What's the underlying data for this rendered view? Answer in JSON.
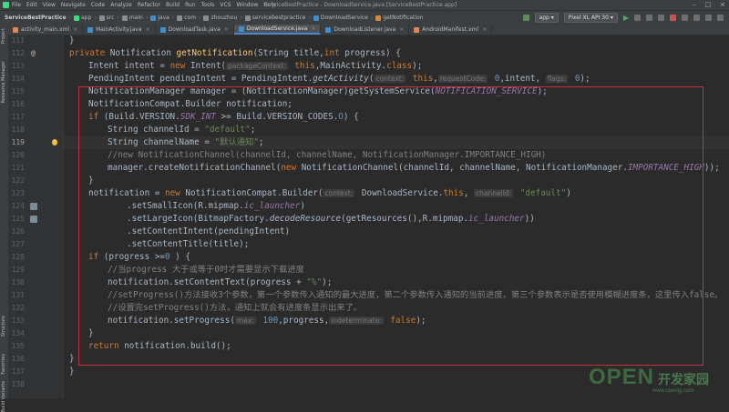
{
  "menubar": {
    "items": [
      "File",
      "Edit",
      "View",
      "Navigate",
      "Code",
      "Analyze",
      "Refactor",
      "Build",
      "Run",
      "Tools",
      "VCS",
      "Window",
      "Help"
    ],
    "window_title": "ServiceBestPractice - DownloadService.java [ServiceBestPractice.app]",
    "window_buttons": [
      "–",
      "□",
      "×"
    ]
  },
  "navbar": {
    "crumbs": [
      "ServiceBestPractice",
      "app",
      "src",
      "main",
      "java",
      "com",
      "zhouzhou",
      "servicebestpractice",
      "DownloadService",
      "getNotification"
    ],
    "config": "app",
    "device": "Pixel XL API 30"
  },
  "tabs": [
    {
      "label": "activity_main.xml",
      "active": false,
      "color": "#e08855"
    },
    {
      "label": "MainActivity.java",
      "active": false,
      "color": "#3d8fd1"
    },
    {
      "label": "DownloadTask.java",
      "active": false,
      "color": "#3d8fd1"
    },
    {
      "label": "DownloadService.java",
      "active": true,
      "color": "#3d8fd1"
    },
    {
      "label": "DownloadListener.java",
      "active": false,
      "color": "#3d8fd1"
    },
    {
      "label": "AndroidManifest.xml",
      "active": false,
      "color": "#e08855"
    }
  ],
  "leftstrip": {
    "items": [
      "Project",
      "Resource Manager",
      "Structure",
      "Favorites",
      "Build Variants"
    ]
  },
  "editor": {
    "current_line": 119,
    "line_numbers": [
      111,
      112,
      113,
      114,
      115,
      116,
      117,
      118,
      119,
      120,
      121,
      122,
      123,
      124,
      125,
      126,
      127,
      128,
      129,
      130,
      131,
      132,
      133,
      134,
      135,
      136,
      137,
      138
    ],
    "lines": [
      {
        "i": 0,
        "segs": [
          [
            "}",
            ""
          ]
        ]
      },
      {
        "i": 0,
        "segs": [
          [
            "private ",
            "kw"
          ],
          [
            "Notification ",
            ""
          ],
          [
            "getNotification",
            "fn"
          ],
          [
            "(String title,",
            ""
          ],
          [
            "int ",
            "kw"
          ],
          [
            "progress) {",
            ""
          ]
        ]
      },
      {
        "i": 1,
        "segs": [
          [
            "Intent intent = ",
            ""
          ],
          [
            "new ",
            "kw"
          ],
          [
            "Intent(",
            ""
          ],
          [
            "packageContext:",
            "hint"
          ],
          [
            " this",
            "kw"
          ],
          [
            ",MainActivity.",
            ""
          ],
          [
            "class",
            "kw"
          ],
          [
            ");",
            ""
          ]
        ]
      },
      {
        "i": 1,
        "segs": [
          [
            "PendingIntent pendingIntent = PendingIntent.",
            ""
          ],
          [
            "getActivity",
            "it"
          ],
          [
            "(",
            ""
          ],
          [
            "context:",
            "hint"
          ],
          [
            " this",
            "kw"
          ],
          [
            ",",
            ""
          ],
          [
            "requestCode:",
            "hint"
          ],
          [
            " 0",
            "num"
          ],
          [
            ",intent, ",
            ""
          ],
          [
            "flags:",
            "hint"
          ],
          [
            " 0",
            "num"
          ],
          [
            ");",
            ""
          ]
        ]
      },
      {
        "i": 1,
        "segs": [
          [
            "NotificationManager manager = (NotificationManager)getSystemService(",
            ""
          ],
          [
            "NOTIFICATION_SERVICE",
            "sf"
          ],
          [
            ");",
            ""
          ]
        ]
      },
      {
        "i": 1,
        "segs": [
          [
            "NotificationCompat.Builder notification;",
            ""
          ]
        ]
      },
      {
        "i": 1,
        "segs": [
          [
            "if ",
            "kw"
          ],
          [
            "(Build.VERSION.",
            ""
          ],
          [
            "SDK_INT",
            "sf"
          ],
          [
            " >= Build.VERSION_CODES.",
            ""
          ],
          [
            "O",
            "num"
          ],
          [
            ") {",
            ""
          ]
        ]
      },
      {
        "i": 2,
        "segs": [
          [
            "String channelId = ",
            ""
          ],
          [
            "\"default\"",
            "str"
          ],
          [
            ";",
            ""
          ]
        ]
      },
      {
        "i": 2,
        "segs": [
          [
            "String channelName = ",
            ""
          ],
          [
            "\"默认通知\"",
            "str"
          ],
          [
            ";",
            ""
          ]
        ]
      },
      {
        "i": 2,
        "segs": [
          [
            "//new NotificationChannel(channelId, channelName, NotificationManager.IMPORTANCE_HIGH)",
            "cmt"
          ]
        ]
      },
      {
        "i": 2,
        "segs": [
          [
            "manager.createNotificationChannel(",
            ""
          ],
          [
            "new ",
            "kw"
          ],
          [
            "NotificationChannel(channelId, channelName, NotificationManager.",
            ""
          ],
          [
            "IMPORTANCE_HIGH",
            "sf"
          ],
          [
            "));",
            ""
          ]
        ]
      },
      {
        "i": 1,
        "segs": [
          [
            "}",
            ""
          ]
        ]
      },
      {
        "i": 1,
        "segs": [
          [
            "notification = ",
            ""
          ],
          [
            "new ",
            "kw"
          ],
          [
            "NotificationCompat.Builder(",
            ""
          ],
          [
            "context:",
            "hint"
          ],
          [
            " DownloadService.",
            ""
          ],
          [
            "this",
            "kw"
          ],
          [
            ", ",
            ""
          ],
          [
            "channelId:",
            "hint"
          ],
          [
            " \"default\"",
            "str"
          ],
          [
            ")",
            ""
          ]
        ]
      },
      {
        "i": 3,
        "segs": [
          [
            ".setSmallIcon(R.mipmap.",
            ""
          ],
          [
            "ic_launcher",
            "sf"
          ],
          [
            ")",
            ""
          ]
        ]
      },
      {
        "i": 3,
        "segs": [
          [
            ".setLargeIcon(BitmapFactory.",
            ""
          ],
          [
            "decodeResource",
            "it"
          ],
          [
            "(getResources(),R.mipmap.",
            ""
          ],
          [
            "ic_launcher",
            "sf"
          ],
          [
            "))",
            ""
          ]
        ]
      },
      {
        "i": 3,
        "segs": [
          [
            ".setContentIntent(pendingIntent)",
            ""
          ]
        ]
      },
      {
        "i": 3,
        "segs": [
          [
            ".setContentTitle(title);",
            ""
          ]
        ]
      },
      {
        "i": 1,
        "segs": [
          [
            "if ",
            "kw"
          ],
          [
            "(progress >=",
            ""
          ],
          [
            "0",
            "num"
          ],
          [
            " ) {",
            ""
          ]
        ]
      },
      {
        "i": 2,
        "segs": [
          [
            "//当progress 大于或等于0时才需要显示下载进度",
            "cmt"
          ]
        ]
      },
      {
        "i": 2,
        "segs": [
          [
            "notification.setContentText(progress + ",
            ""
          ],
          [
            "\"%\"",
            "str"
          ],
          [
            ");",
            ""
          ]
        ]
      },
      {
        "i": 2,
        "segs": [
          [
            "//setProgress()方法接收3个参数，第一个参数传入通知的最大进度，第二个参数传入通知的当前进度，第三个参数表示是否使用模糊进度条，这里传入false。",
            "cmt"
          ]
        ]
      },
      {
        "i": 2,
        "segs": [
          [
            "//设置完setProgress()方法，通知上就会有进度条显示出来了。",
            "cmt"
          ]
        ]
      },
      {
        "i": 2,
        "segs": [
          [
            "notification.setProgress(",
            ""
          ],
          [
            "max:",
            "hint"
          ],
          [
            " 100",
            "num"
          ],
          [
            ",progress,",
            ""
          ],
          [
            "indeterminate:",
            "hint"
          ],
          [
            " false",
            "kw"
          ],
          [
            ");",
            ""
          ]
        ]
      },
      {
        "i": 1,
        "segs": [
          [
            "}",
            ""
          ]
        ]
      },
      {
        "i": 1,
        "segs": [
          [
            "return ",
            "kw"
          ],
          [
            "notification.build();",
            ""
          ]
        ]
      },
      {
        "i": 0,
        "segs": [
          [
            "}",
            ""
          ]
        ]
      },
      {
        "i": 0,
        "segs": [
          [
            "}",
            ""
          ]
        ]
      },
      {
        "i": 0,
        "segs": [
          [
            "",
            ""
          ]
        ]
      }
    ]
  },
  "watermark": {
    "brand": "OPEN",
    "chinese": "开发家园",
    "url": "www.openjg.com"
  }
}
